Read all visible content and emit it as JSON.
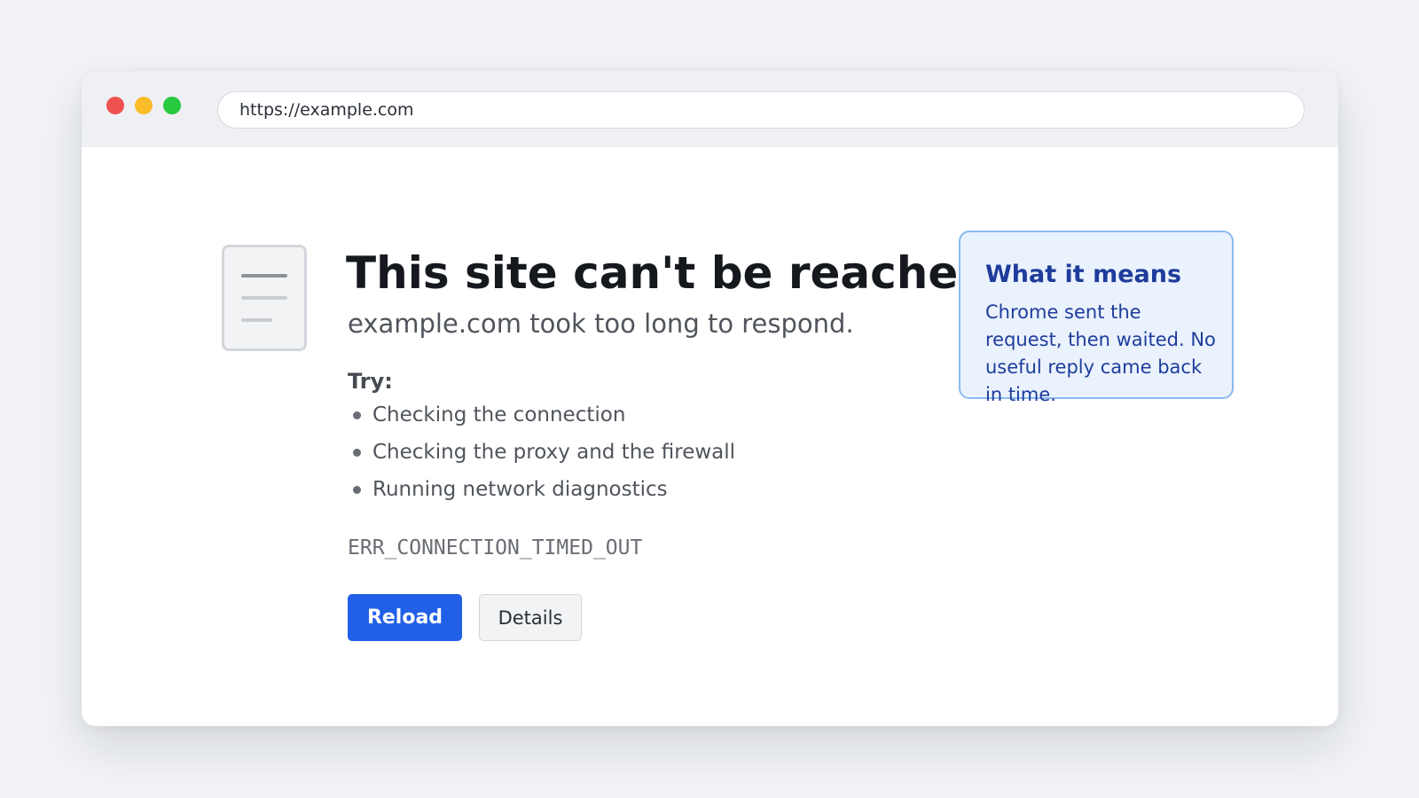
{
  "browser": {
    "url": "https://example.com"
  },
  "error_page": {
    "title": "This site can't be reached",
    "subtitle": "example.com took too long to respond.",
    "try_label": "Try:",
    "suggestions": [
      "Checking the connection",
      "Checking the proxy and the firewall",
      "Running network diagnostics"
    ],
    "error_code": "ERR_CONNECTION_TIMED_OUT",
    "reload_label": "Reload",
    "details_label": "Details",
    "icon": "document-icon"
  },
  "callout": {
    "title": "What it means",
    "body": "Chrome sent the request, then waited. No useful reply came back in time."
  },
  "colors": {
    "primary_button": "#2160e6",
    "callout_border": "#8cbaf0",
    "callout_text": "#1e3c9c",
    "dot_red": "#ef5350",
    "dot_yellow": "#fbbc2a",
    "dot_green": "#27c93f"
  }
}
